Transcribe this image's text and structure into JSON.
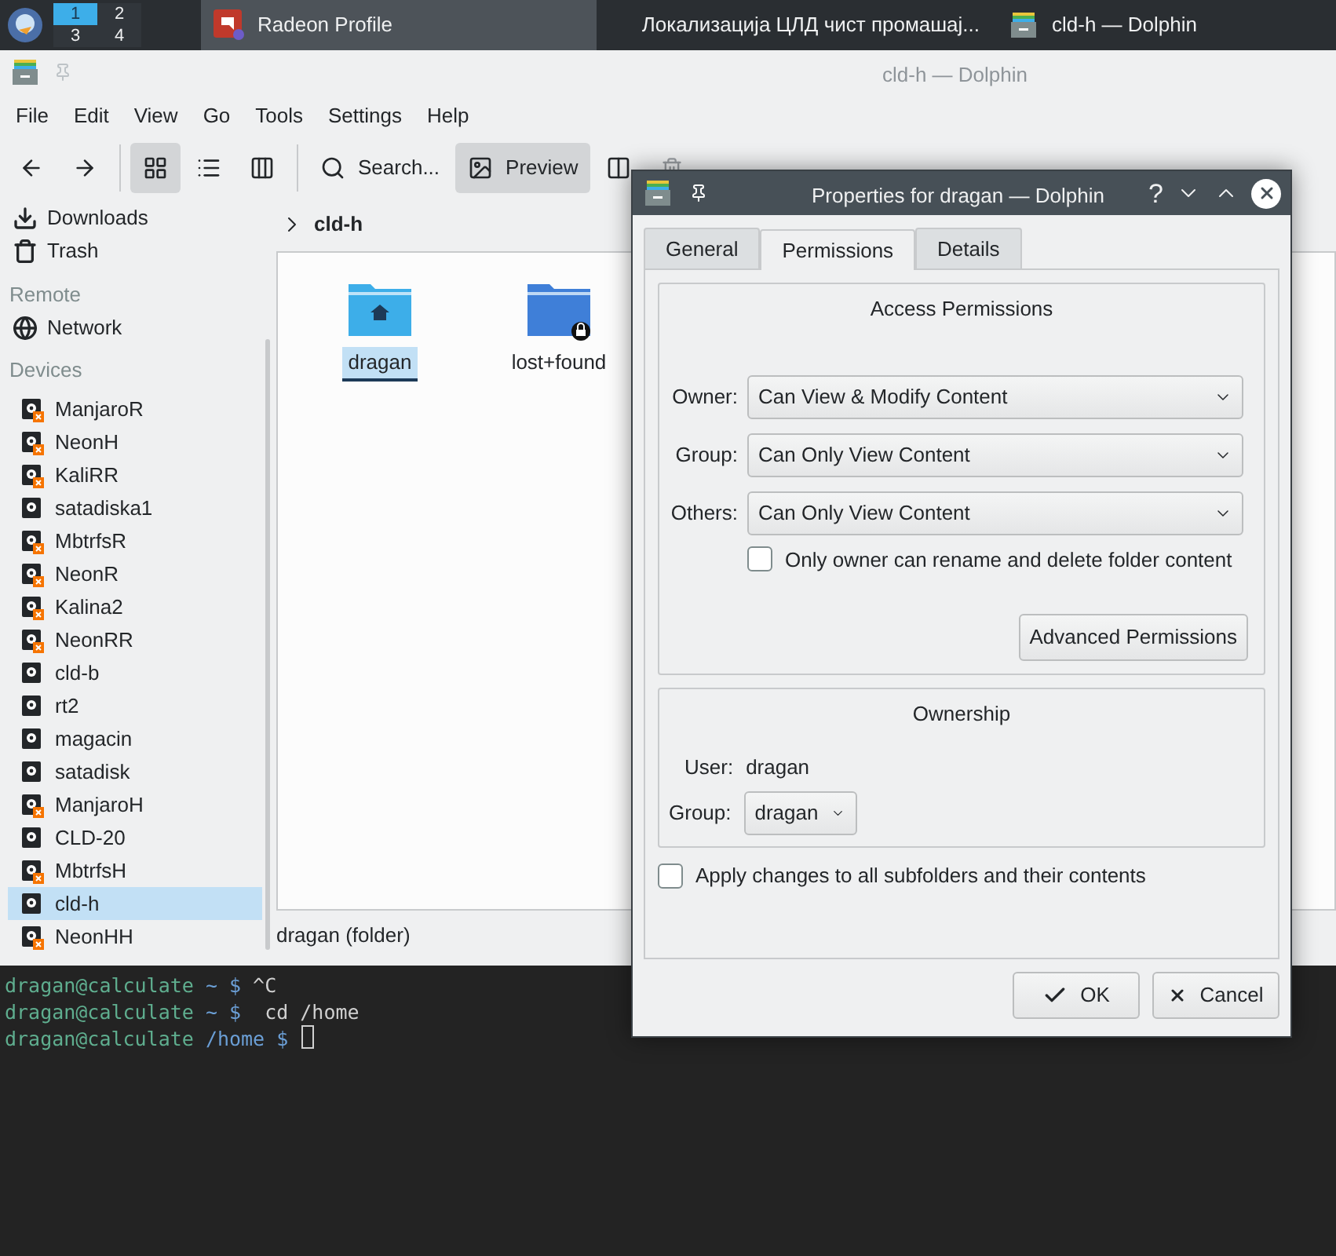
{
  "taskbar": {
    "pager": [
      {
        "label": "1",
        "selected": true
      },
      {
        "label": "2",
        "selected": false
      },
      {
        "label": "3",
        "selected": false
      },
      {
        "label": "4",
        "selected": false
      }
    ],
    "tasks": [
      {
        "label": "Radeon Profile",
        "selected": true,
        "kind": "radeon"
      },
      {
        "label": "Локализација ЦЛД чист промашај...",
        "selected": false,
        "kind": "none"
      },
      {
        "label": "cld-h — Dolphin",
        "selected": false,
        "kind": "dolphin"
      }
    ]
  },
  "window": {
    "title": "cld-h — Dolphin",
    "menu": [
      "File",
      "Edit",
      "View",
      "Go",
      "Tools",
      "Settings",
      "Help"
    ],
    "toolbar": [
      {
        "kind": "back",
        "selected": false,
        "disabled": false
      },
      {
        "kind": "forward",
        "selected": false,
        "disabled": false
      },
      {
        "kind": "icons",
        "selected": true,
        "disabled": false
      },
      {
        "kind": "details",
        "selected": false,
        "disabled": false
      },
      {
        "kind": "compact",
        "selected": false,
        "disabled": false
      },
      {
        "kind": "search",
        "label": "Search...",
        "selected": false,
        "disabled": false
      },
      {
        "kind": "preview",
        "label": "Preview",
        "selected": true,
        "disabled": false
      },
      {
        "kind": "split",
        "selected": false,
        "disabled": false
      },
      {
        "kind": "delete",
        "selected": false,
        "disabled": true
      }
    ],
    "sidebar": {
      "places": [
        {
          "kind": "download",
          "label": "Downloads"
        },
        {
          "kind": "trash",
          "label": "Trash"
        }
      ],
      "remote": {
        "header": "Remote",
        "items": [
          {
            "kind": "network",
            "label": "Network"
          }
        ]
      },
      "devices": {
        "header": "Devices",
        "items": [
          {
            "label": "ManjaroR",
            "mounted": false,
            "selected": false
          },
          {
            "label": "NeonH",
            "mounted": false,
            "selected": false
          },
          {
            "label": "KaliRR",
            "mounted": false,
            "selected": false
          },
          {
            "label": "satadiska1",
            "mounted": true,
            "selected": false
          },
          {
            "label": "MbtrfsR",
            "mounted": false,
            "selected": false
          },
          {
            "label": "NeonR",
            "mounted": false,
            "selected": false
          },
          {
            "label": "Kalina2",
            "mounted": false,
            "selected": false
          },
          {
            "label": "NeonRR",
            "mounted": false,
            "selected": false
          },
          {
            "label": "cld-b",
            "mounted": true,
            "selected": false
          },
          {
            "label": "rt2",
            "mounted": true,
            "selected": false
          },
          {
            "label": "magacin",
            "mounted": true,
            "selected": false
          },
          {
            "label": "satadisk",
            "mounted": true,
            "selected": false
          },
          {
            "label": "ManjaroH",
            "mounted": false,
            "selected": false
          },
          {
            "label": "CLD-20",
            "mounted": true,
            "selected": false
          },
          {
            "label": "MbtrfsH",
            "mounted": false,
            "selected": false
          },
          {
            "label": "cld-h",
            "mounted": true,
            "selected": true
          },
          {
            "label": "NeonHH",
            "mounted": false,
            "selected": false
          }
        ]
      }
    },
    "breadcrumb": "cld-h",
    "files": [
      {
        "name": "dragan",
        "kind": "home",
        "selected": true
      },
      {
        "name": "lost+found",
        "kind": "locked",
        "selected": false
      }
    ],
    "status": "dragan (folder)"
  },
  "dialog": {
    "title": "Properties for dragan — Dolphin",
    "help": "?",
    "tabs": [
      {
        "label": "General",
        "selected": false
      },
      {
        "label": "Permissions",
        "selected": true
      },
      {
        "label": "Details",
        "selected": false
      }
    ],
    "access": {
      "title": "Access Permissions",
      "rows": [
        {
          "label": "Owner:",
          "value": "Can View & Modify Content"
        },
        {
          "label": "Group:",
          "value": "Can Only View Content"
        },
        {
          "label": "Others:",
          "value": "Can Only View Content"
        }
      ],
      "only_owner": {
        "label": "Only owner can rename and delete folder content",
        "checked": false
      },
      "advanced": "Advanced Permissions"
    },
    "ownership": {
      "title": "Ownership",
      "user_label": "User:",
      "user": "dragan",
      "group_label": "Group:",
      "group": "dragan"
    },
    "apply": {
      "label": "Apply changes to all subfolders and their contents",
      "checked": false
    },
    "buttons": [
      {
        "kind": "ok",
        "label": "OK"
      },
      {
        "kind": "cancel",
        "label": "Cancel"
      }
    ]
  },
  "terminal": {
    "lines": [
      {
        "user": "dragan@calculate",
        "path": "~ $",
        "command": "^C"
      },
      {
        "user": "dragan@calculate",
        "path": "~ $",
        "command": " cd /home"
      },
      {
        "user": "dragan@calculate",
        "path": "/home $",
        "cursor": true
      }
    ]
  }
}
